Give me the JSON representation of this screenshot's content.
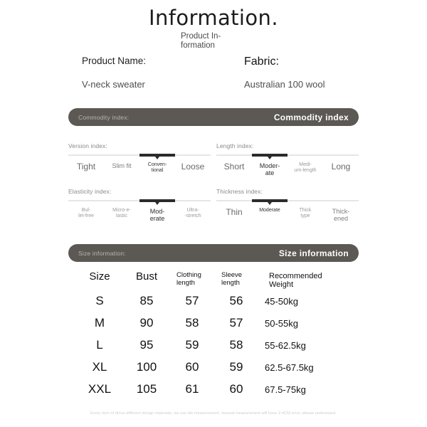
{
  "header": {
    "title": "Information.",
    "subtitle": "Product In-formation"
  },
  "product": {
    "name_label": "Product Name:",
    "name_value": "V-neck sweater",
    "fabric_label": "Fabric:",
    "fabric_value": "Australian 100 wool"
  },
  "banners": {
    "commodity": {
      "left": "Commodity index:",
      "right": "Commodity index"
    },
    "size": {
      "left": "Size information:",
      "right": "Size information"
    }
  },
  "indexes": [
    {
      "caption": "Version index:",
      "selected": 2,
      "options": [
        {
          "label": "Tight",
          "size": "lg"
        },
        {
          "label": "Slim fit",
          "size": "md"
        },
        {
          "label": "Conven-\ntional",
          "size": "sm"
        },
        {
          "label": "Loose",
          "size": "lg"
        }
      ]
    },
    {
      "caption": "Length index:",
      "selected": 1,
      "options": [
        {
          "label": "Short",
          "size": "lg"
        },
        {
          "label": "Moder-\nate",
          "size": "md"
        },
        {
          "label": "Medi-\num-length",
          "size": "sm"
        },
        {
          "label": "Long",
          "size": "lg"
        }
      ]
    },
    {
      "caption": "Elasticity index:",
      "selected": 2,
      "options": [
        {
          "label": "Bul-\nlet-free",
          "size": "sm"
        },
        {
          "label": "Micro-e-\nlastic",
          "size": "sm"
        },
        {
          "label": "Mod-\nerate",
          "size": "md"
        },
        {
          "label": "Ultra-\n-stretch",
          "size": "sm"
        }
      ]
    },
    {
      "caption": "Thickness index:",
      "selected": 1,
      "options": [
        {
          "label": "Thin",
          "size": "lg"
        },
        {
          "label": "Moderate",
          "size": "sm"
        },
        {
          "label": "Thick\ntype",
          "size": "sm"
        },
        {
          "label": "Thick-\nened",
          "size": "md"
        }
      ]
    }
  ],
  "size_table": {
    "headers": [
      "Size",
      "Bust",
      "Clothing\nlength",
      "Sleeve\nlength",
      "Recommended\nWeight"
    ],
    "rows": [
      {
        "size": "S",
        "bust": "85",
        "clothing_length": "57",
        "sleeve_length": "56",
        "weight": "45-50kg"
      },
      {
        "size": "M",
        "bust": "90",
        "clothing_length": "58",
        "sleeve_length": "57",
        "weight": "50-55kg"
      },
      {
        "size": "L",
        "bust": "95",
        "clothing_length": "59",
        "sleeve_length": "58",
        "weight": "55-62.5kg"
      },
      {
        "size": "XL",
        "bust": "100",
        "clothing_length": "60",
        "sleeve_length": "59",
        "weight": "62.5-67.5kg"
      },
      {
        "size": "XXL",
        "bust": "105",
        "clothing_length": "61",
        "sleeve_length": "60",
        "weight": "67.5-75kg"
      }
    ]
  },
  "footer": {
    "note": "Every item of dress different design materials, we use tile measurement, manual measurement will have 2-4CM error, please understand."
  },
  "colors": {
    "banner_background": "#5c5853",
    "banner_text": "#ffffff",
    "banner_subtext": "#b9b4af",
    "track": "#e6e6e6",
    "track_selected": "#2b2b2b",
    "page_background": "#ffffff"
  }
}
